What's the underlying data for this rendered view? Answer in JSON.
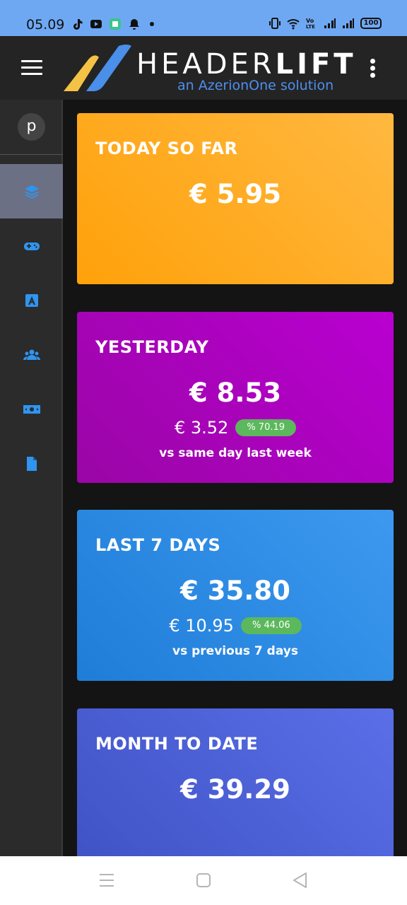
{
  "status_bar": {
    "time": "05.09",
    "battery": "100"
  },
  "app_bar": {
    "brand_prefix": "HEADER",
    "brand_suffix": "LIFT",
    "tagline": "an AzerionOne solution",
    "logo_colors": [
      "#f4c245",
      "#4a8fe9"
    ]
  },
  "sidebar": {
    "avatar_letter": "p",
    "items": [
      {
        "icon": "layers-icon",
        "active": true
      },
      {
        "icon": "gamepad-icon",
        "active": false
      },
      {
        "icon": "font-a-icon",
        "active": false
      },
      {
        "icon": "users-icon",
        "active": false
      },
      {
        "icon": "money-icon",
        "active": false
      },
      {
        "icon": "file-icon",
        "active": false
      }
    ],
    "icon_color": "#2f95ef"
  },
  "cards": {
    "today": {
      "title": "TODAY SO FAR",
      "amount": "€ 5.95"
    },
    "yesterday": {
      "title": "YESTERDAY",
      "amount": "€ 8.53",
      "delta": "€ 3.52",
      "percent": "% 70.19",
      "caption": "vs same day last week"
    },
    "week": {
      "title": "LAST 7 DAYS",
      "amount": "€ 35.80",
      "delta": "€ 10.95",
      "percent": "% 44.06",
      "caption": "vs previous 7 days"
    },
    "month": {
      "title": "MONTH TO DATE",
      "amount": "€ 39.29"
    }
  },
  "colors": {
    "today": "#ffa10a",
    "yesterday": "#b000c8",
    "week": "#2b8ae4",
    "month": "#4b60d8",
    "badge": "#5cb85c"
  }
}
